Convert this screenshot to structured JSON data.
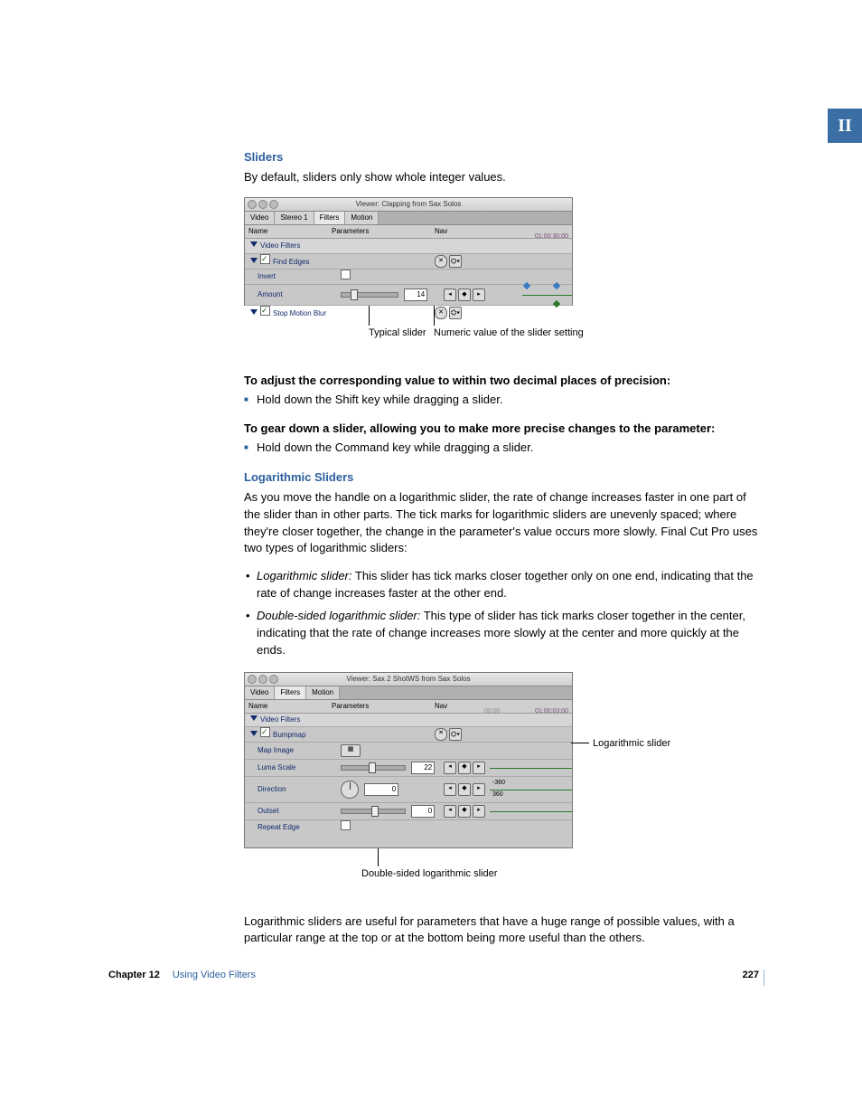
{
  "part_label": "II",
  "headings": {
    "sliders": "Sliders",
    "log": "Logarithmic Sliders"
  },
  "paras": {
    "p1": "By default, sliders only show whole integer values.",
    "b1": "To adjust the corresponding value to within two decimal places of precision:",
    "li1": "Hold down the Shift key while dragging a slider.",
    "b2": "To gear down a slider, allowing you to make more precise changes to the parameter:",
    "li2": "Hold down the Command key while dragging a slider.",
    "p2": "As you move the handle on a logarithmic slider, the rate of change increases faster in one part of the slider than in other parts. The tick marks for logarithmic sliders are unevenly spaced; where they're closer together, the change in the parameter's value occurs more slowly. Final Cut Pro uses two types of logarithmic sliders:",
    "d1_term": "Logarithmic slider:",
    "d1_body": "  This slider has tick marks closer together only on one end, indicating that the rate of change increases faster at the other end.",
    "d2_term": "Double-sided logarithmic slider:",
    "d2_body": "  This type of slider has tick marks closer together in the center, indicating that the rate of change increases more slowly at the center and more quickly at the ends.",
    "p3": "Logarithmic sliders are useful for parameters that have a huge range of possible values, with a particular range at the top or at the bottom being more useful than the others."
  },
  "fig1": {
    "window_title": "Viewer: Clapping from Sax Solos",
    "tabs": [
      "Video",
      "Stereo 1",
      "Filters",
      "Motion"
    ],
    "active_tab": 2,
    "headers": {
      "name": "Name",
      "param": "Parameters",
      "nav": "Nav"
    },
    "timecode": "01:00:30:00",
    "rows": {
      "group": "Video Filters",
      "filter1": "Find Edges",
      "invert": "Invert",
      "amount": "Amount",
      "amount_val": "14",
      "filter2": "Stop Motion Blur"
    },
    "callouts": {
      "typical": "Typical slider",
      "numeric": "Numeric value of the slider setting"
    }
  },
  "fig2": {
    "window_title": "Viewer: Sax 2 ShotWS from Sax Solos",
    "tabs": [
      "Video",
      "Filters",
      "Motion"
    ],
    "active_tab": 1,
    "headers": {
      "name": "Name",
      "param": "Parameters",
      "nav": "Nav"
    },
    "tc_left": "00:00",
    "tc_right": "01:00:03:00",
    "rows": {
      "group": "Video Filters",
      "filter": "Bumpmap",
      "map": "Map Image",
      "luma": "Luma Scale",
      "luma_val": "22",
      "dir": "Direction",
      "dir_val": "0",
      "dir_hi": "360",
      "dir_lo": "-360",
      "outset": "Outset",
      "outset_val": "0",
      "repeat": "Repeat Edge"
    },
    "callouts": {
      "log": "Logarithmic slider",
      "dbl": "Double-sided logarithmic slider"
    }
  },
  "footer": {
    "chapter": "Chapter 12",
    "title": "Using Video Filters",
    "page": "227"
  }
}
